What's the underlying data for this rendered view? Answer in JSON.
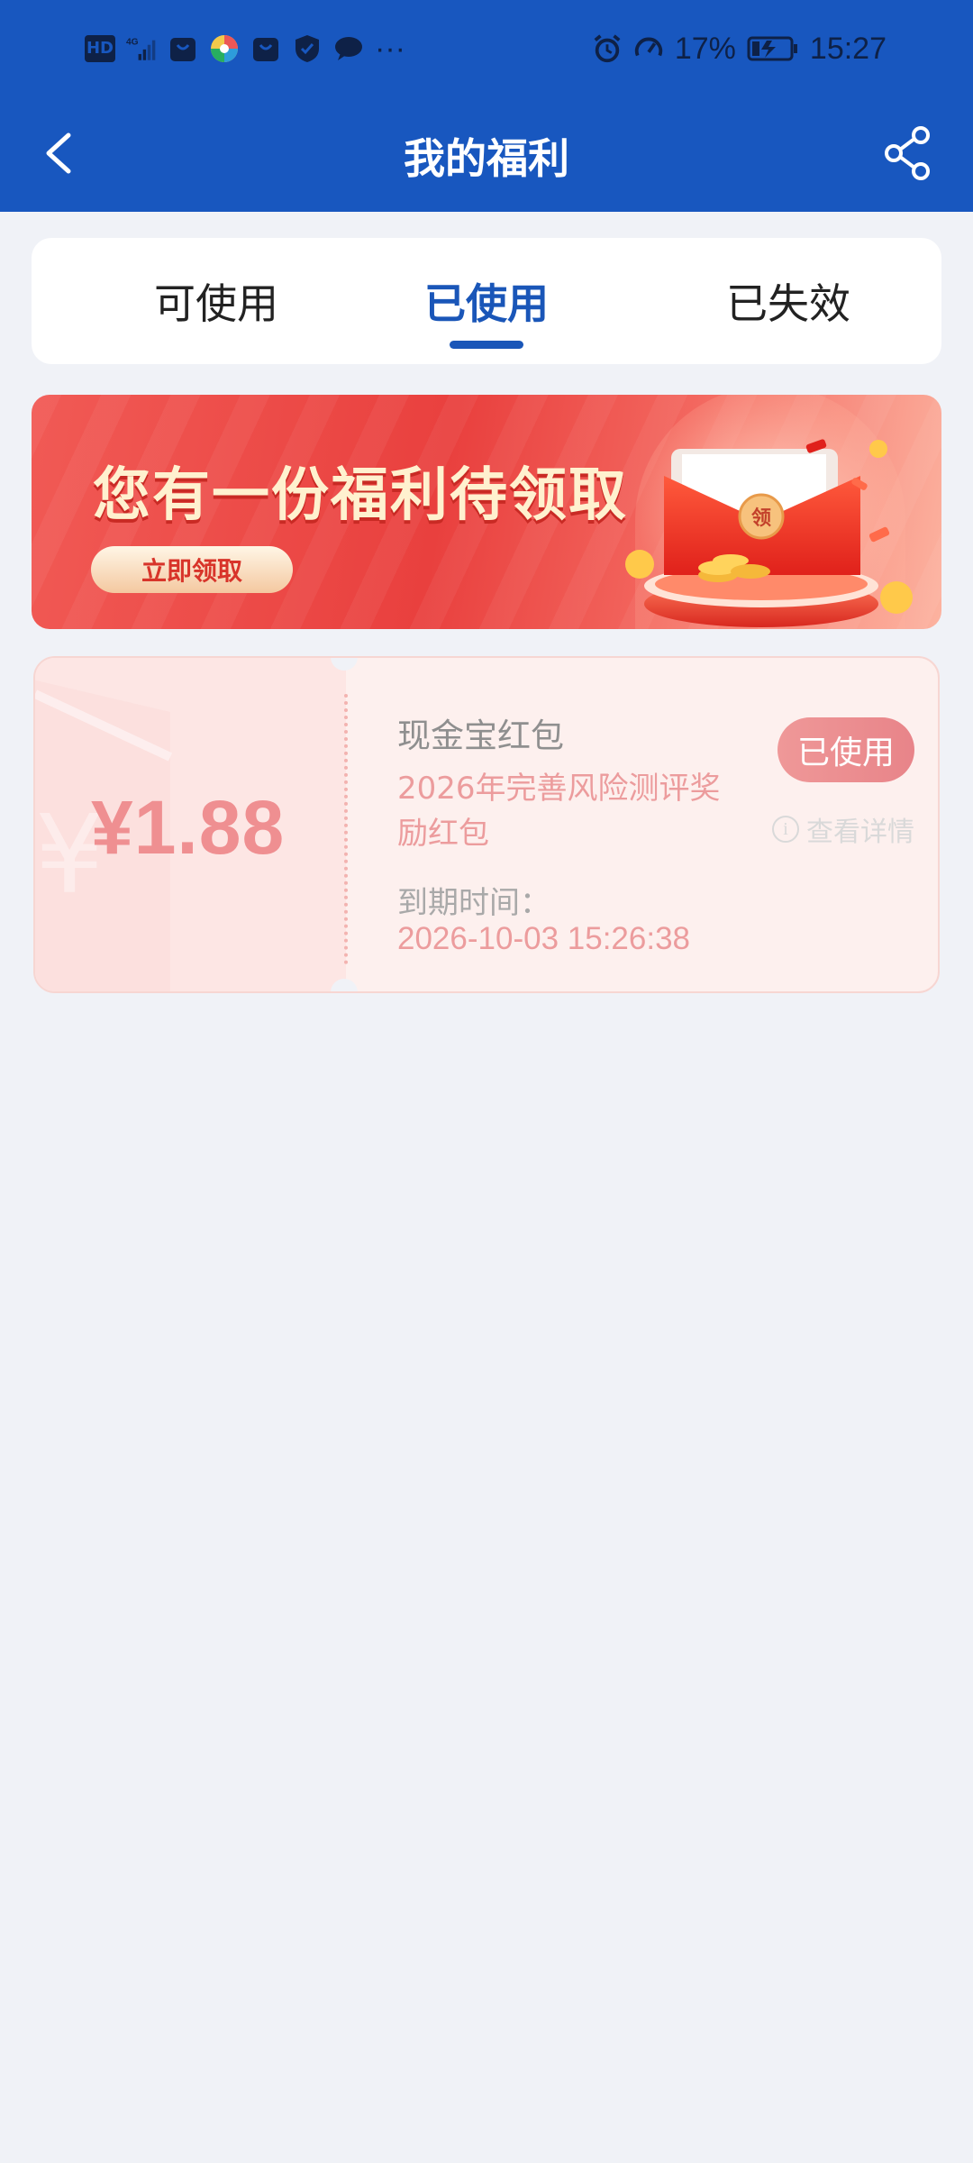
{
  "status_bar": {
    "network": "4G",
    "battery": "17%",
    "time": "15:27",
    "hd_label": "HD",
    "more": "···"
  },
  "nav": {
    "title": "我的福利"
  },
  "tabs": [
    {
      "label": "可使用",
      "active": false
    },
    {
      "label": "已使用",
      "active": true
    },
    {
      "label": "已失效",
      "active": false
    }
  ],
  "banner": {
    "title": "您有一份福利待领取",
    "button_label": "立即领取",
    "envelope_char": "领"
  },
  "coupon": {
    "amount": "¥1.88",
    "name": "现金宝红包",
    "description": "2026年完善风险测评奖励红包",
    "expire_label": "到期时间：",
    "expire_time": "2026-10-03 15:26:38",
    "status": "已使用",
    "detail_link": "查看详情"
  },
  "colors": {
    "header": "#1857bf",
    "accent": "#1a56b8",
    "coupon_text": "#ec9c9d"
  }
}
